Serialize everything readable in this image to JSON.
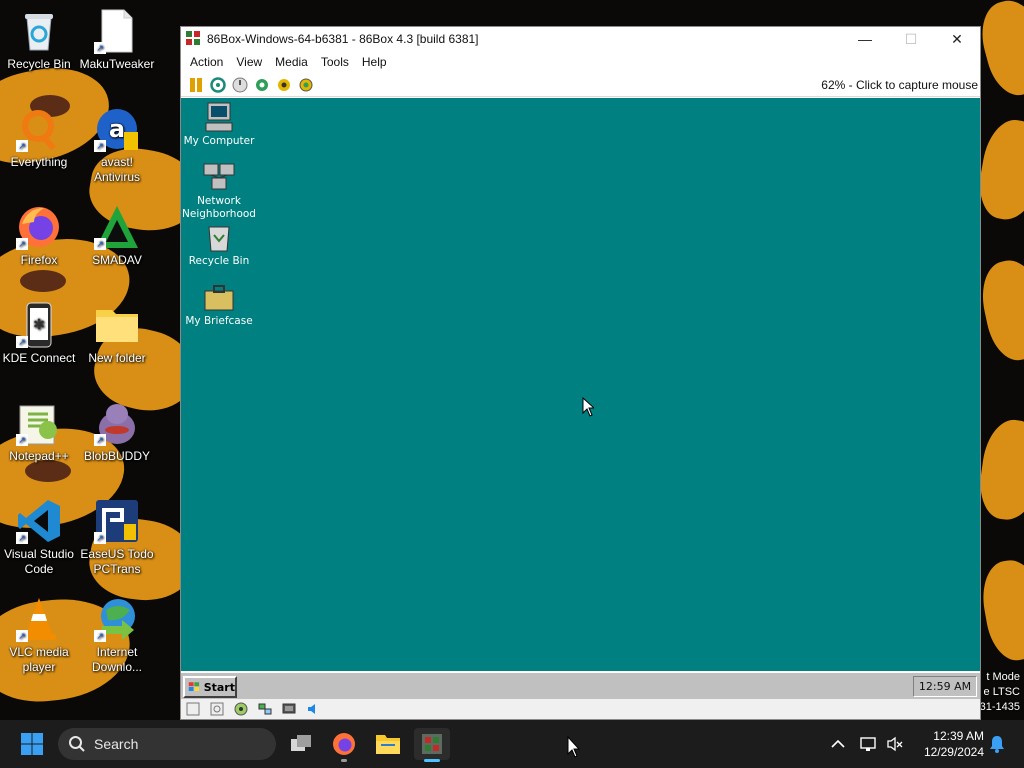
{
  "desktop_icons": [
    {
      "label": "Recycle Bin",
      "icon": "recycle-bin-icon"
    },
    {
      "label": "MakuTweaker",
      "icon": "document-icon"
    },
    {
      "label": "Everything",
      "icon": "everything-search-icon"
    },
    {
      "label": "avast! Antivirus",
      "icon": "avast-icon"
    },
    {
      "label": "Firefox",
      "icon": "firefox-icon"
    },
    {
      "label": "SMADAV",
      "icon": "smadav-icon"
    },
    {
      "label": "KDE Connect",
      "icon": "kde-connect-icon"
    },
    {
      "label": "New folder",
      "icon": "folder-icon"
    },
    {
      "label": "Notepad++",
      "icon": "notepad-plus-plus-icon"
    },
    {
      "label": "BlobBUDDY",
      "icon": "blobbuddy-icon"
    },
    {
      "label": "Visual Studio Code",
      "icon": "vscode-icon"
    },
    {
      "label": "EaseUS Todo PCTrans",
      "icon": "easeus-icon"
    },
    {
      "label": "VLC media player",
      "icon": "vlc-icon"
    },
    {
      "label": "Internet Downlo...",
      "icon": "internet-download-manager-icon"
    }
  ],
  "watermark": {
    "line1": "t Mode",
    "line2": "e LTSC",
    "line3": "31-1435"
  },
  "window": {
    "title": "86Box-Windows-64-b6381 - 86Box 4.3 [build 6381]",
    "minimize": "—",
    "maximize": "☐",
    "close": "✕",
    "menu": [
      "Action",
      "View",
      "Media",
      "Tools",
      "Help"
    ],
    "capture_message": "62% - Click to capture mouse"
  },
  "emulated": {
    "icons": [
      {
        "label": "My Computer",
        "icon": "my-computer-icon"
      },
      {
        "label": "Network Neighborhood",
        "icon": "network-neighborhood-icon"
      },
      {
        "label": "Recycle Bin",
        "icon": "recycle-bin-icon"
      },
      {
        "label": "My Briefcase",
        "icon": "briefcase-icon"
      }
    ],
    "start_label": "Start",
    "clock": "12:59 AM",
    "desktop_color": "#008080"
  },
  "taskbar": {
    "search_placeholder": "Search",
    "time": "12:39 AM",
    "date": "12/29/2024"
  }
}
